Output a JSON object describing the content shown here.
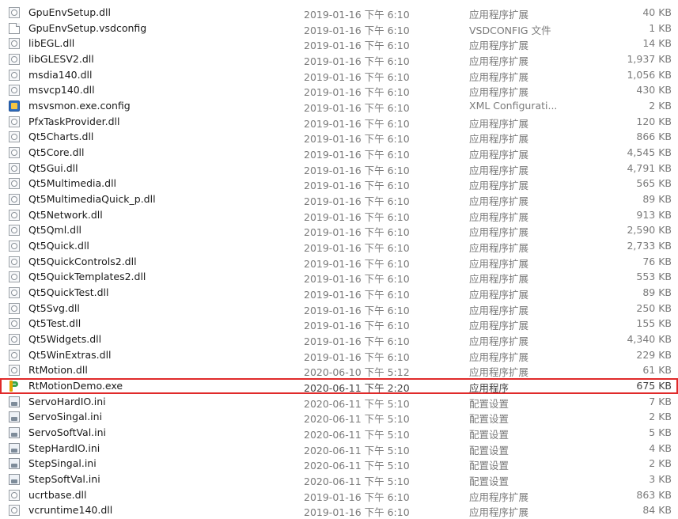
{
  "file_list": {
    "highlight_color": "#e02a2a",
    "rows": [
      {
        "name": "GpuEnvSetup.dll",
        "date": "2019-01-16 下午 6:10",
        "type": "应用程序扩展",
        "size": "40 KB",
        "icon": "dll-file-icon"
      },
      {
        "name": "GpuEnvSetup.vsdconfig",
        "date": "2019-01-16 下午 6:10",
        "type": "VSDCONFIG 文件",
        "size": "1 KB",
        "icon": "blank-file-icon"
      },
      {
        "name": "libEGL.dll",
        "date": "2019-01-16 下午 6:10",
        "type": "应用程序扩展",
        "size": "14 KB",
        "icon": "dll-file-icon"
      },
      {
        "name": "libGLESV2.dll",
        "date": "2019-01-16 下午 6:10",
        "type": "应用程序扩展",
        "size": "1,937 KB",
        "icon": "dll-file-icon"
      },
      {
        "name": "msdia140.dll",
        "date": "2019-01-16 下午 6:10",
        "type": "应用程序扩展",
        "size": "1,056 KB",
        "icon": "dll-file-icon"
      },
      {
        "name": "msvcp140.dll",
        "date": "2019-01-16 下午 6:10",
        "type": "应用程序扩展",
        "size": "430 KB",
        "icon": "dll-file-icon"
      },
      {
        "name": "msvsmon.exe.config",
        "date": "2019-01-16 下午 6:10",
        "type": "XML Configurati...",
        "size": "2 KB",
        "icon": "xml-config-icon"
      },
      {
        "name": "PfxTaskProvider.dll",
        "date": "2019-01-16 下午 6:10",
        "type": "应用程序扩展",
        "size": "120 KB",
        "icon": "dll-file-icon"
      },
      {
        "name": "Qt5Charts.dll",
        "date": "2019-01-16 下午 6:10",
        "type": "应用程序扩展",
        "size": "866 KB",
        "icon": "dll-file-icon"
      },
      {
        "name": "Qt5Core.dll",
        "date": "2019-01-16 下午 6:10",
        "type": "应用程序扩展",
        "size": "4,545 KB",
        "icon": "dll-file-icon"
      },
      {
        "name": "Qt5Gui.dll",
        "date": "2019-01-16 下午 6:10",
        "type": "应用程序扩展",
        "size": "4,791 KB",
        "icon": "dll-file-icon"
      },
      {
        "name": "Qt5Multimedia.dll",
        "date": "2019-01-16 下午 6:10",
        "type": "应用程序扩展",
        "size": "565 KB",
        "icon": "dll-file-icon"
      },
      {
        "name": "Qt5MultimediaQuick_p.dll",
        "date": "2019-01-16 下午 6:10",
        "type": "应用程序扩展",
        "size": "89 KB",
        "icon": "dll-file-icon"
      },
      {
        "name": "Qt5Network.dll",
        "date": "2019-01-16 下午 6:10",
        "type": "应用程序扩展",
        "size": "913 KB",
        "icon": "dll-file-icon"
      },
      {
        "name": "Qt5Qml.dll",
        "date": "2019-01-16 下午 6:10",
        "type": "应用程序扩展",
        "size": "2,590 KB",
        "icon": "dll-file-icon"
      },
      {
        "name": "Qt5Quick.dll",
        "date": "2019-01-16 下午 6:10",
        "type": "应用程序扩展",
        "size": "2,733 KB",
        "icon": "dll-file-icon"
      },
      {
        "name": "Qt5QuickControls2.dll",
        "date": "2019-01-16 下午 6:10",
        "type": "应用程序扩展",
        "size": "76 KB",
        "icon": "dll-file-icon"
      },
      {
        "name": "Qt5QuickTemplates2.dll",
        "date": "2019-01-16 下午 6:10",
        "type": "应用程序扩展",
        "size": "553 KB",
        "icon": "dll-file-icon"
      },
      {
        "name": "Qt5QuickTest.dll",
        "date": "2019-01-16 下午 6:10",
        "type": "应用程序扩展",
        "size": "89 KB",
        "icon": "dll-file-icon"
      },
      {
        "name": "Qt5Svg.dll",
        "date": "2019-01-16 下午 6:10",
        "type": "应用程序扩展",
        "size": "250 KB",
        "icon": "dll-file-icon"
      },
      {
        "name": "Qt5Test.dll",
        "date": "2019-01-16 下午 6:10",
        "type": "应用程序扩展",
        "size": "155 KB",
        "icon": "dll-file-icon"
      },
      {
        "name": "Qt5Widgets.dll",
        "date": "2019-01-16 下午 6:10",
        "type": "应用程序扩展",
        "size": "4,340 KB",
        "icon": "dll-file-icon"
      },
      {
        "name": "Qt5WinExtras.dll",
        "date": "2019-01-16 下午 6:10",
        "type": "应用程序扩展",
        "size": "229 KB",
        "icon": "dll-file-icon"
      },
      {
        "name": "RtMotion.dll",
        "date": "2020-06-10 下午 5:12",
        "type": "应用程序扩展",
        "size": "61 KB",
        "icon": "dll-file-icon"
      },
      {
        "name": "RtMotionDemo.exe",
        "date": "2020-06-11 下午 2:20",
        "type": "应用程序",
        "size": "675 KB",
        "icon": "exe-app-icon",
        "highlighted": true
      },
      {
        "name": "ServoHardIO.ini",
        "date": "2020-06-11 下午 5:10",
        "type": "配置设置",
        "size": "7 KB",
        "icon": "ini-settings-icon"
      },
      {
        "name": "ServoSingal.ini",
        "date": "2020-06-11 下午 5:10",
        "type": "配置设置",
        "size": "2 KB",
        "icon": "ini-settings-icon"
      },
      {
        "name": "ServoSoftVal.ini",
        "date": "2020-06-11 下午 5:10",
        "type": "配置设置",
        "size": "5 KB",
        "icon": "ini-settings-icon"
      },
      {
        "name": "StepHardIO.ini",
        "date": "2020-06-11 下午 5:10",
        "type": "配置设置",
        "size": "4 KB",
        "icon": "ini-settings-icon"
      },
      {
        "name": "StepSingal.ini",
        "date": "2020-06-11 下午 5:10",
        "type": "配置设置",
        "size": "2 KB",
        "icon": "ini-settings-icon"
      },
      {
        "name": "StepSoftVal.ini",
        "date": "2020-06-11 下午 5:10",
        "type": "配置设置",
        "size": "3 KB",
        "icon": "ini-settings-icon"
      },
      {
        "name": "ucrtbase.dll",
        "date": "2019-01-16 下午 6:10",
        "type": "应用程序扩展",
        "size": "863 KB",
        "icon": "dll-file-icon"
      },
      {
        "name": "vcruntime140.dll",
        "date": "2019-01-16 下午 6:10",
        "type": "应用程序扩展",
        "size": "84 KB",
        "icon": "dll-file-icon"
      }
    ]
  }
}
